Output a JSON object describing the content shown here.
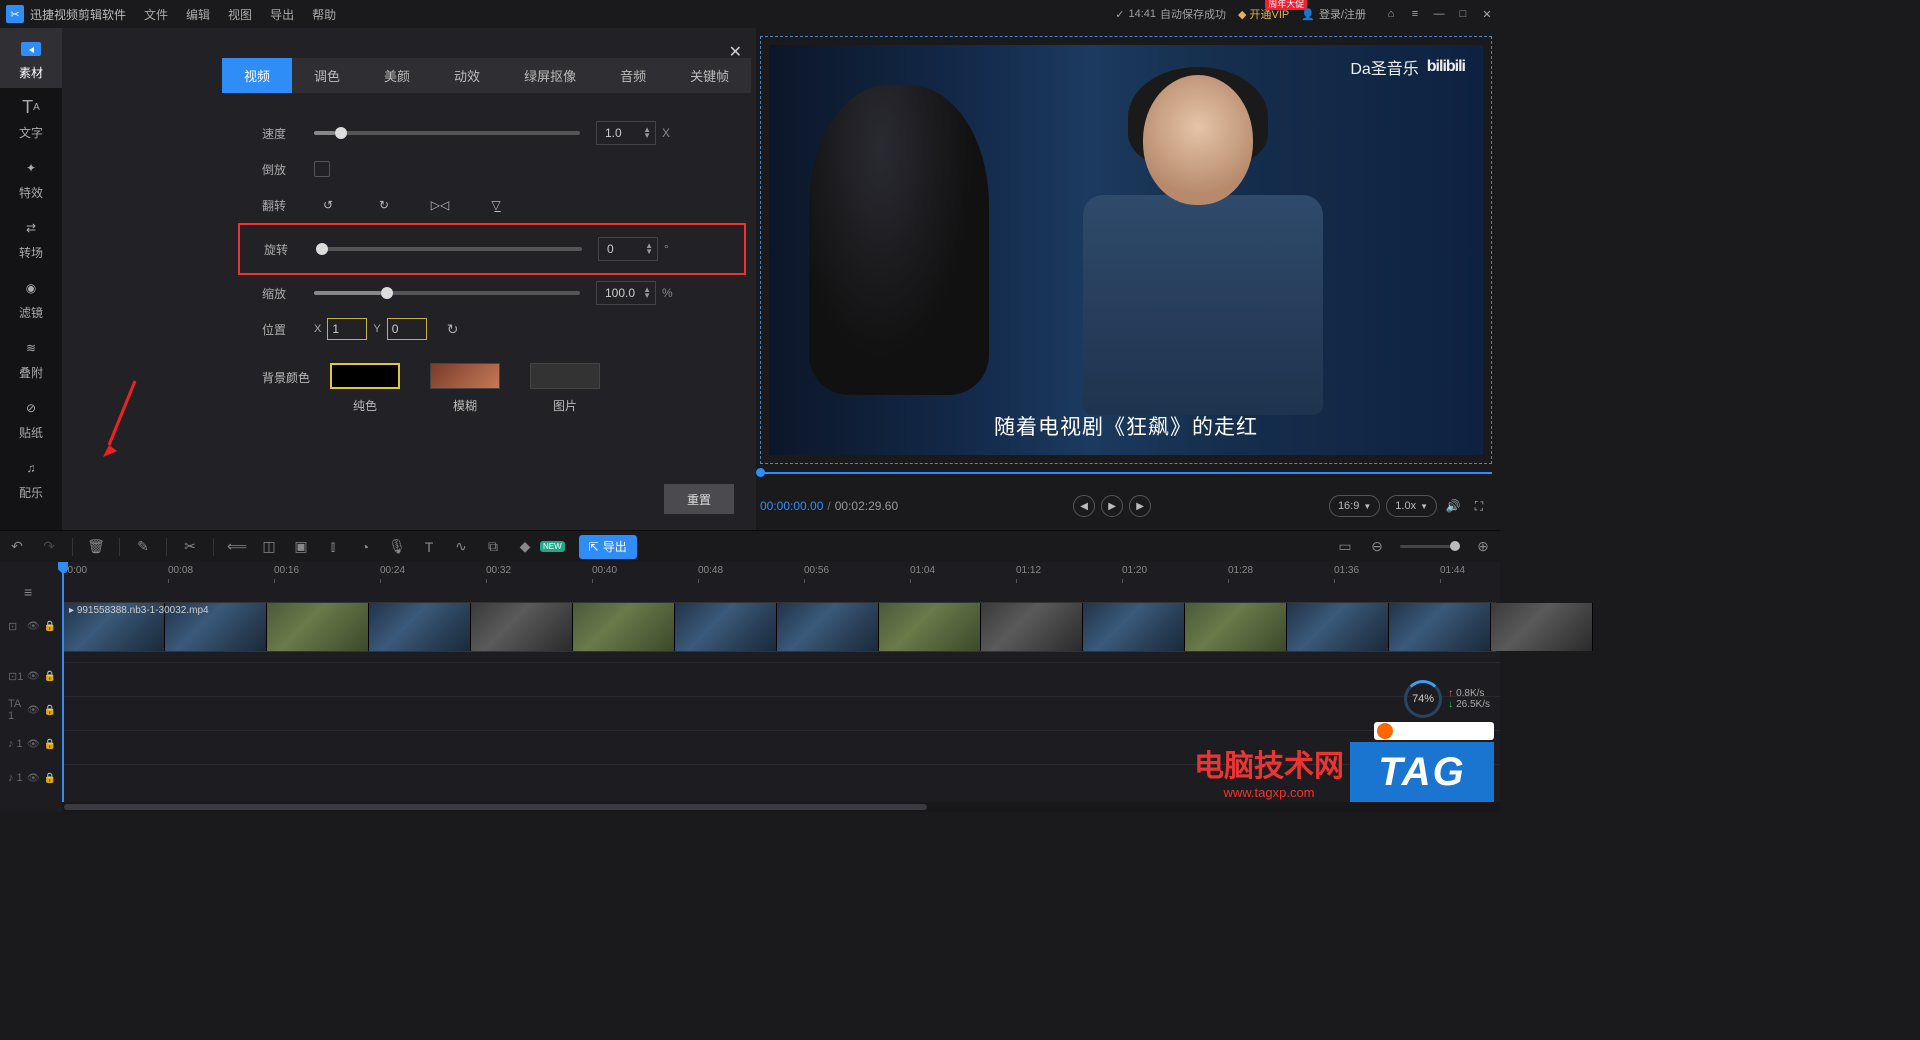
{
  "titlebar": {
    "app_name": "迅捷视频剪辑软件",
    "menu": [
      "文件",
      "编辑",
      "视图",
      "导出",
      "帮助"
    ],
    "save_time": "14:41",
    "save_text": "自动保存成功",
    "vip_text": "开通VIP",
    "vip_badge": "周年大促",
    "login": "登录/注册"
  },
  "leftstrip": [
    {
      "label": "素材"
    },
    {
      "label": "文字"
    },
    {
      "label": "特效"
    },
    {
      "label": "转场"
    },
    {
      "label": "滤镜"
    },
    {
      "label": "叠附"
    },
    {
      "label": "贴纸"
    },
    {
      "label": "配乐"
    }
  ],
  "panel": {
    "tabs": [
      "视频",
      "调色",
      "美颜",
      "动效",
      "绿屏抠像",
      "音频",
      "关键帧"
    ],
    "active_tab": 0,
    "speed": {
      "label": "速度",
      "value": "1.0",
      "unit": "X",
      "pos": 8
    },
    "reverse": {
      "label": "倒放"
    },
    "flip": {
      "label": "翻转"
    },
    "rotate": {
      "label": "旋转",
      "value": "0",
      "unit": "°",
      "pos": 0
    },
    "scale": {
      "label": "缩放",
      "value": "100.0",
      "unit": "%",
      "pos": 25
    },
    "position": {
      "label": "位置",
      "x_label": "X",
      "x": "1",
      "y_label": "Y",
      "y": "0"
    },
    "bg": {
      "label": "背景颜色",
      "solid": "纯色",
      "blur": "模糊",
      "image": "图片"
    },
    "reset": "重置"
  },
  "preview": {
    "watermark_text": "Da圣音乐",
    "watermark_brand": "bilibili",
    "subtitle": "随着电视剧《狂飙》的走红",
    "cur": "00:00:00.00",
    "sep": "/",
    "total": "00:02:29.60",
    "ratio": "16:9",
    "speed": "1.0x"
  },
  "toolbar": {
    "export": "导出",
    "new": "NEW"
  },
  "timeline": {
    "marks": [
      "00:00",
      "00:08",
      "00:16",
      "00:24",
      "00:32",
      "00:40",
      "00:48",
      "00:56",
      "01:04",
      "01:12",
      "01:20",
      "01:28",
      "01:36",
      "01:44"
    ],
    "clip_name": "991558388.nb3-1-30032.mp4",
    "lanes": [
      "⊡1",
      "TA 1",
      "♪ 1",
      "♪ 1"
    ]
  },
  "net": {
    "percent": "74%",
    "up": "0.8K/s",
    "down": "26.5K/s"
  },
  "wm": {
    "zh": "电脑技术网",
    "url": "www.tagxp.com",
    "tag": "TAG"
  }
}
